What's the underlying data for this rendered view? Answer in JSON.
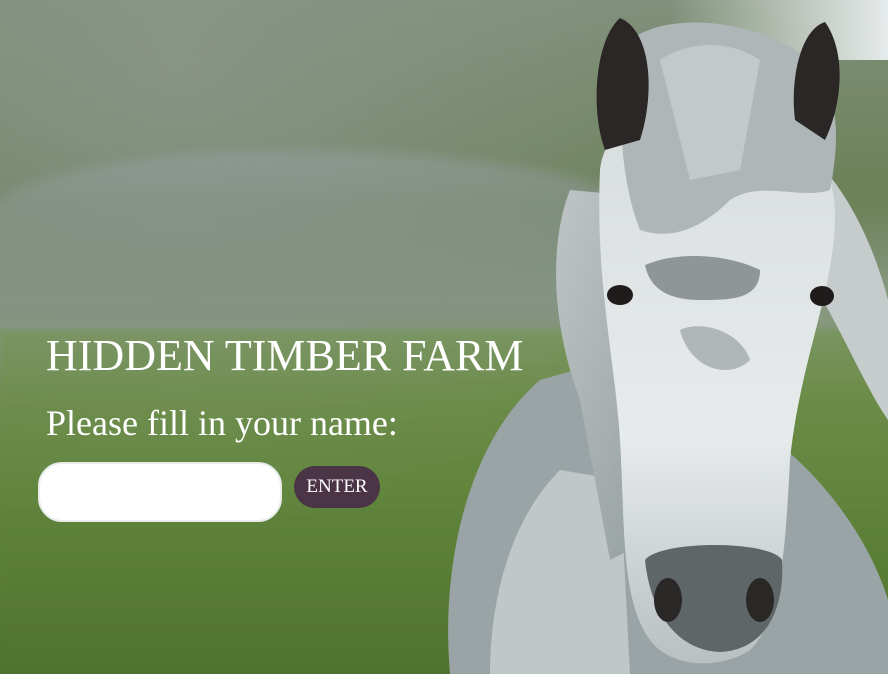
{
  "header": {
    "title": "HIDDEN TIMBER FARM"
  },
  "form": {
    "prompt": "Please fill in your name:",
    "name_value": "",
    "enter_label": "ENTER"
  },
  "colors": {
    "button_bg": "#4a3446",
    "text": "#ffffff"
  },
  "background": {
    "icon": "grey-horse-in-meadow-photo"
  }
}
